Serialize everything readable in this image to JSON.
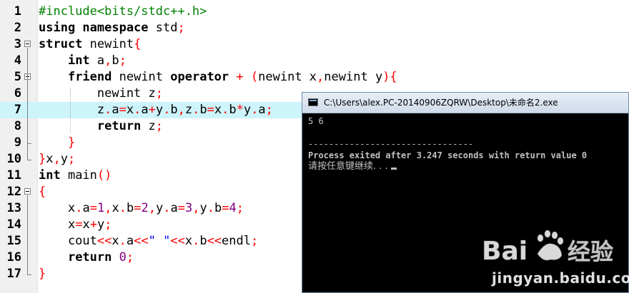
{
  "editor": {
    "lines": [
      {
        "n": "1",
        "tokens": [
          {
            "t": "#include<bits/stdc++.h>",
            "c": "pp"
          }
        ]
      },
      {
        "n": "2",
        "tokens": [
          {
            "t": "using namespace",
            "c": "kw"
          },
          {
            "t": " std",
            "c": ""
          },
          {
            "t": ";",
            "c": "op"
          }
        ]
      },
      {
        "n": "3",
        "tokens": [
          {
            "t": "struct",
            "c": "kw"
          },
          {
            "t": " newint",
            "c": ""
          },
          {
            "t": "{",
            "c": "op"
          }
        ]
      },
      {
        "n": "4",
        "tokens": [
          {
            "t": "    ",
            "c": ""
          },
          {
            "t": "int",
            "c": "kw"
          },
          {
            "t": " a",
            "c": ""
          },
          {
            "t": ",",
            "c": "op"
          },
          {
            "t": "b",
            "c": ""
          },
          {
            "t": ";",
            "c": "op"
          }
        ]
      },
      {
        "n": "5",
        "tokens": [
          {
            "t": "    ",
            "c": ""
          },
          {
            "t": "friend",
            "c": "kw"
          },
          {
            "t": " newint ",
            "c": ""
          },
          {
            "t": "operator",
            "c": "kw"
          },
          {
            "t": " ",
            "c": ""
          },
          {
            "t": "+",
            "c": "op"
          },
          {
            "t": " ",
            "c": ""
          },
          {
            "t": "(",
            "c": "op"
          },
          {
            "t": "newint x",
            "c": ""
          },
          {
            "t": ",",
            "c": "op"
          },
          {
            "t": "newint y",
            "c": ""
          },
          {
            "t": "){",
            "c": "op"
          }
        ]
      },
      {
        "n": "6",
        "tokens": [
          {
            "t": "        newint z",
            "c": ""
          },
          {
            "t": ";",
            "c": "op"
          }
        ]
      },
      {
        "n": "7",
        "tokens": [
          {
            "t": "        z",
            "c": ""
          },
          {
            "t": ".",
            "c": "op"
          },
          {
            "t": "a",
            "c": ""
          },
          {
            "t": "=",
            "c": "op"
          },
          {
            "t": "x",
            "c": ""
          },
          {
            "t": ".",
            "c": "op"
          },
          {
            "t": "a",
            "c": ""
          },
          {
            "t": "+",
            "c": "op"
          },
          {
            "t": "y",
            "c": ""
          },
          {
            "t": ".",
            "c": "op"
          },
          {
            "t": "b",
            "c": ""
          },
          {
            "t": ",",
            "c": "op"
          },
          {
            "t": "z",
            "c": ""
          },
          {
            "t": ".",
            "c": "op"
          },
          {
            "t": "b",
            "c": ""
          },
          {
            "t": "=",
            "c": "op"
          },
          {
            "t": "x",
            "c": ""
          },
          {
            "t": ".",
            "c": "op"
          },
          {
            "t": "b",
            "c": ""
          },
          {
            "t": "*",
            "c": "op"
          },
          {
            "t": "y",
            "c": ""
          },
          {
            "t": ".",
            "c": "op"
          },
          {
            "t": "a",
            "c": ""
          },
          {
            "t": ";",
            "c": "op"
          }
        ]
      },
      {
        "n": "8",
        "tokens": [
          {
            "t": "        ",
            "c": ""
          },
          {
            "t": "return",
            "c": "kw"
          },
          {
            "t": " z",
            "c": ""
          },
          {
            "t": ";",
            "c": "op"
          }
        ]
      },
      {
        "n": "9",
        "tokens": [
          {
            "t": "    ",
            "c": ""
          },
          {
            "t": "}",
            "c": "op"
          }
        ]
      },
      {
        "n": "10",
        "tokens": [
          {
            "t": "}",
            "c": "op"
          },
          {
            "t": "x",
            "c": ""
          },
          {
            "t": ",",
            "c": "op"
          },
          {
            "t": "y",
            "c": ""
          },
          {
            "t": ";",
            "c": "op"
          }
        ]
      },
      {
        "n": "11",
        "tokens": [
          {
            "t": "int",
            "c": "kw"
          },
          {
            "t": " main",
            "c": ""
          },
          {
            "t": "()",
            "c": "op"
          }
        ]
      },
      {
        "n": "12",
        "tokens": [
          {
            "t": "{",
            "c": "op"
          }
        ]
      },
      {
        "n": "13",
        "tokens": [
          {
            "t": "    x",
            "c": ""
          },
          {
            "t": ".",
            "c": "op"
          },
          {
            "t": "a",
            "c": ""
          },
          {
            "t": "=",
            "c": "op"
          },
          {
            "t": "1",
            "c": "num"
          },
          {
            "t": ",",
            "c": "op"
          },
          {
            "t": "x",
            "c": ""
          },
          {
            "t": ".",
            "c": "op"
          },
          {
            "t": "b",
            "c": ""
          },
          {
            "t": "=",
            "c": "op"
          },
          {
            "t": "2",
            "c": "num"
          },
          {
            "t": ",",
            "c": "op"
          },
          {
            "t": "y",
            "c": ""
          },
          {
            "t": ".",
            "c": "op"
          },
          {
            "t": "a",
            "c": ""
          },
          {
            "t": "=",
            "c": "op"
          },
          {
            "t": "3",
            "c": "num"
          },
          {
            "t": ",",
            "c": "op"
          },
          {
            "t": "y",
            "c": ""
          },
          {
            "t": ".",
            "c": "op"
          },
          {
            "t": "b",
            "c": ""
          },
          {
            "t": "=",
            "c": "op"
          },
          {
            "t": "4",
            "c": "num"
          },
          {
            "t": ";",
            "c": "op"
          }
        ]
      },
      {
        "n": "14",
        "tokens": [
          {
            "t": "    x",
            "c": ""
          },
          {
            "t": "=",
            "c": "op"
          },
          {
            "t": "x",
            "c": ""
          },
          {
            "t": "+",
            "c": "op"
          },
          {
            "t": "y",
            "c": ""
          },
          {
            "t": ";",
            "c": "op"
          }
        ]
      },
      {
        "n": "15",
        "tokens": [
          {
            "t": "    cout",
            "c": ""
          },
          {
            "t": "<<",
            "c": "op"
          },
          {
            "t": "x",
            "c": ""
          },
          {
            "t": ".",
            "c": "op"
          },
          {
            "t": "a",
            "c": ""
          },
          {
            "t": "<<",
            "c": "op"
          },
          {
            "t": "\" \"",
            "c": "str"
          },
          {
            "t": "<<",
            "c": "op"
          },
          {
            "t": "x",
            "c": ""
          },
          {
            "t": ".",
            "c": "op"
          },
          {
            "t": "b",
            "c": ""
          },
          {
            "t": "<<",
            "c": "op"
          },
          {
            "t": "endl",
            "c": ""
          },
          {
            "t": ";",
            "c": "op"
          }
        ]
      },
      {
        "n": "16",
        "tokens": [
          {
            "t": "    ",
            "c": ""
          },
          {
            "t": "return",
            "c": "kw"
          },
          {
            "t": " ",
            "c": ""
          },
          {
            "t": "0",
            "c": "num"
          },
          {
            "t": ";",
            "c": "op"
          }
        ]
      },
      {
        "n": "17",
        "tokens": [
          {
            "t": "}",
            "c": "op"
          }
        ]
      }
    ],
    "highlighted_line": "7",
    "fold_lines": [
      "3",
      "5",
      "12"
    ]
  },
  "console": {
    "title": "C:\\Users\\alex.PC-20140906ZQRW\\Desktop\\未命名2.exe",
    "output_line1": "5 6",
    "separator": "--------------------------------",
    "exit_message": "Process exited after 3.247 seconds with return value 0",
    "prompt": "请按任意键继续. . ."
  },
  "watermark": {
    "brand": "Bai经验",
    "url": "jingyan.baidu.com"
  },
  "colors": {
    "keyword": "#000000",
    "preprocessor": "#008000",
    "operator": "#ff0000",
    "number": "#800080",
    "string": "#0000ff",
    "highlight_line": "#cdf4fb",
    "console_bg": "#000000",
    "console_text": "#c0c0c0"
  }
}
